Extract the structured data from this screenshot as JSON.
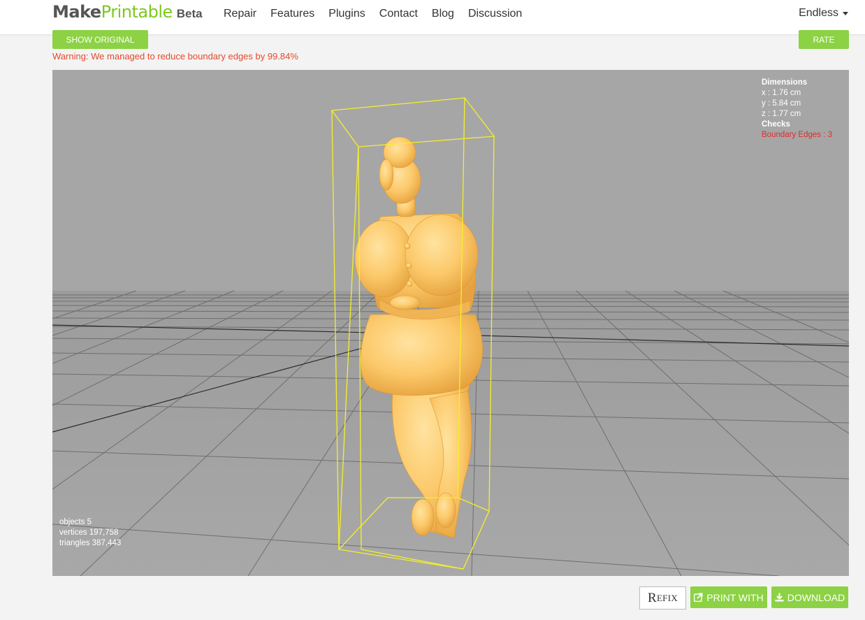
{
  "brand": {
    "make": "Make",
    "printable": "Printable",
    "beta": "Beta"
  },
  "nav": {
    "links": [
      "Repair",
      "Features",
      "Plugins",
      "Contact",
      "Blog",
      "Discussion"
    ],
    "user": "Endless"
  },
  "toolbar": {
    "show_original_label": "SHOW ORIGINAL",
    "rate_label": "RATE"
  },
  "warning": "Warning: We managed to reduce boundary edges by 99.84%",
  "viewer": {
    "dimensions": {
      "heading": "Dimensions",
      "x": "x :  1.76 cm",
      "y": "y :  5.84 cm",
      "z": "z :  1.77 cm"
    },
    "checks": {
      "heading": "Checks",
      "boundary_edges": "Boundary Edges :  3"
    },
    "stats": {
      "objects": "objects  5",
      "vertices": "vertices  197,758",
      "triangles": "triangles  387,443"
    }
  },
  "actions": {
    "refix_first": "R",
    "refix_rest": "EFIX",
    "print_with_label": "PRINT WITH",
    "download_label": "DOWNLOAD"
  },
  "colors": {
    "accent": "#8cd244",
    "warning": "#e5492b",
    "viewer_bg": "#a6a6a6",
    "model": "#fcc96a",
    "bounding_box": "#f5f02a",
    "error": "#e02c2c"
  }
}
